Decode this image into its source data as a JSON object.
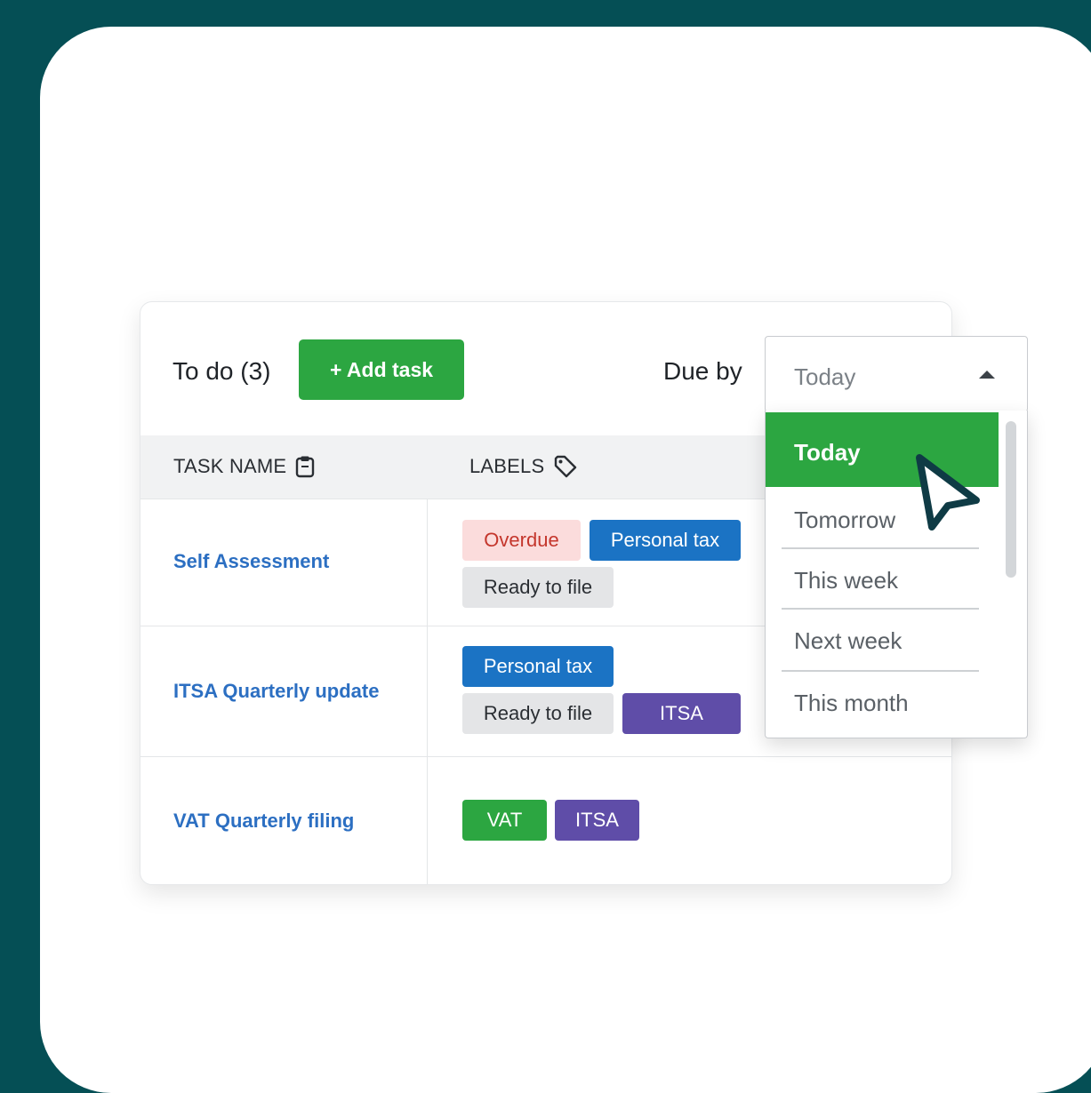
{
  "header": {
    "todo_title": "To do (3)",
    "add_task_label": "+ Add task",
    "due_by_label": "Due by"
  },
  "table": {
    "columns": [
      {
        "label": "TASK NAME",
        "icon": "clipboard-icon"
      },
      {
        "label": "LABELS",
        "icon": "tag-icon"
      }
    ],
    "rows": [
      {
        "task": "Self Assessment",
        "labels": [
          "Overdue",
          "Personal tax",
          "Ready to file"
        ]
      },
      {
        "task": "ITSA Quarterly update",
        "labels": [
          "Personal tax",
          "Ready to file",
          "ITSA"
        ]
      },
      {
        "task": "VAT Quarterly filing",
        "labels": [
          "VAT",
          "ITSA"
        ]
      }
    ]
  },
  "due_select": {
    "value": "Today",
    "options": [
      "Today",
      "Tomorrow",
      "This week",
      "Next week",
      "This month"
    ],
    "highlighted": "Today"
  },
  "colors": {
    "background": "#054f55",
    "accent_green": "#2ca641",
    "personal_tax_blue": "#1b73c4",
    "itsa_purple": "#5f4da8",
    "overdue_bg": "#fbdcdc",
    "overdue_text": "#c4362c",
    "task_link": "#2c6fc2"
  }
}
